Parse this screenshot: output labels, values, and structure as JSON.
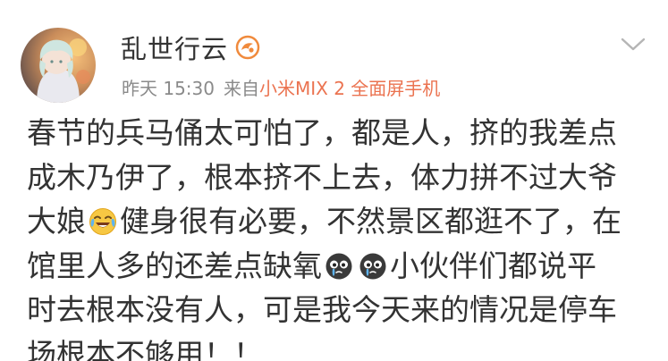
{
  "user": {
    "name": "乱世行云"
  },
  "meta": {
    "time": "昨天 15:30",
    "source_prefix": "来自",
    "source": "小米MIX 2 全面屏手机"
  },
  "post": {
    "line1": "春节的兵马俑太可怕了，都是人，挤的我差点",
    "line2": "成木乃伊了，根本挤不上去，体力拼不过大爷",
    "line3a": "大娘",
    "line3b": "健身很有必要，不然景区都逛不了，在",
    "line4a": "馆里人多的还差点缺氧",
    "line4b": "小伙伴们都说平",
    "line5": "时去根本没有人，可是我今天来的情况是停车",
    "line6": "场根本不够用！！"
  },
  "icons": {
    "avatar": "anime-character-avatar",
    "badge": "member-crown-badge",
    "menu": "chevron-down-icon",
    "emoji_laugh_cry": "laughing-crying-emoji",
    "emoji_sad": "crying-black-emoji"
  },
  "colors": {
    "source_link": "#eb7350",
    "text": "#333333",
    "meta": "#8a8a8a"
  }
}
